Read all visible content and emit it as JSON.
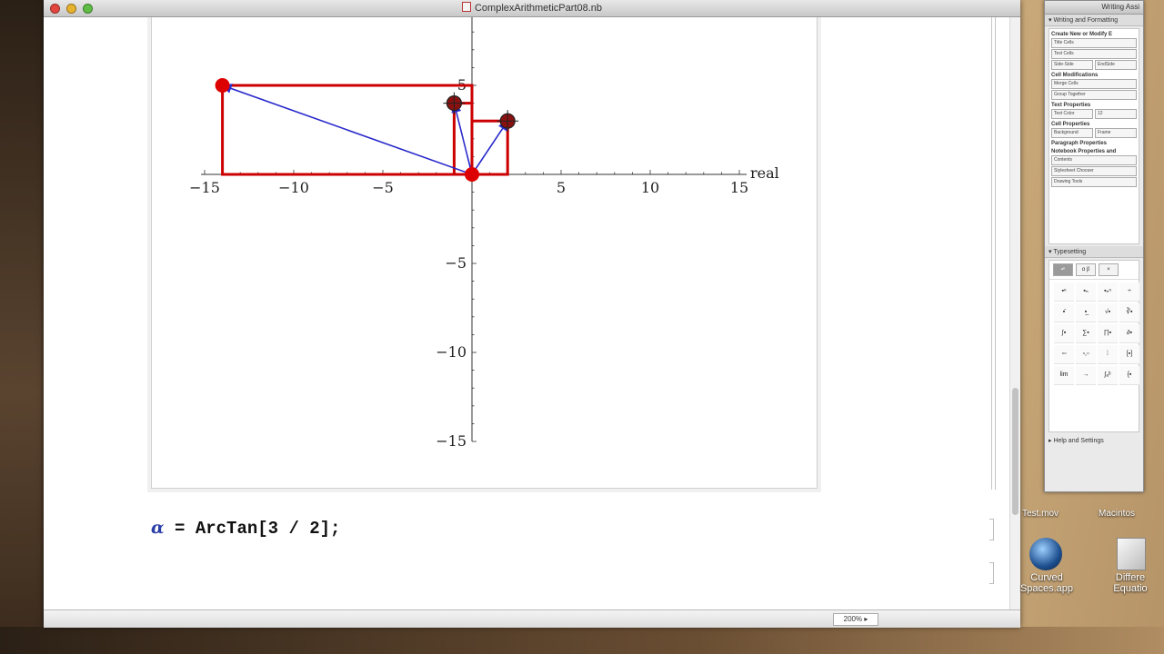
{
  "window": {
    "title": "ComplexArithmeticPart08.nb",
    "zoom": "200%"
  },
  "plot": {
    "x_ticks": [
      "−15",
      "−10",
      "−5",
      "5",
      "10",
      "15"
    ],
    "y_ticks": [
      "5",
      "−5",
      "−10",
      "−15"
    ],
    "x_axis_label": "real",
    "colors": {
      "rect": "#cc0000",
      "arrow": "#2a2acc",
      "point": "#dd0000"
    }
  },
  "chart_data": {
    "type": "scatter",
    "xlabel": "real",
    "ylabel": "",
    "xlim": [
      -15,
      15
    ],
    "ylim": [
      -15,
      5
    ],
    "points": [
      {
        "x": -14,
        "y": 5
      },
      {
        "x": -1,
        "y": 4
      },
      {
        "x": 2,
        "y": 3
      },
      {
        "x": 0,
        "y": 0
      }
    ],
    "arrows": [
      {
        "from": [
          0,
          0
        ],
        "to": [
          -14,
          5
        ]
      },
      {
        "from": [
          0,
          0
        ],
        "to": [
          -1,
          4
        ]
      },
      {
        "from": [
          0,
          0
        ],
        "to": [
          2,
          3
        ]
      }
    ],
    "rectangles": [
      {
        "x0": -14,
        "x1": 0,
        "y0": 0,
        "y1": 5
      },
      {
        "x0": -1,
        "x1": 0,
        "y0": 0,
        "y1": 4
      },
      {
        "x0": 0,
        "x1": 2,
        "y0": 0,
        "y1": 3
      }
    ]
  },
  "cell": {
    "alpha": "α",
    "code": " = ArcTan[3 / 2];"
  },
  "palette": {
    "title": "Writing Assi",
    "section_writing": "Writing and Formatting",
    "create_label": "Create New or Modify E",
    "title_cells": "Title Cells",
    "text_cells": "Text Cells",
    "side_by_side": "Side-Side",
    "end_side": "EndSide",
    "cell_mod_label": "Cell Modifications",
    "merge_cells": "Merge Cells",
    "group_together": "Group Together",
    "text_props_label": "Text Properties",
    "text_color": "Text Color",
    "size": "12",
    "cell_props_label": "Cell Properties",
    "background": "Background",
    "frame": "Frame",
    "para_props_label": "Paragraph Properties",
    "nb_props_label": "Notebook Properties and",
    "contents": "Contents",
    "stylesheet": "Stylesheet Chooser",
    "drawing_tools": "Drawing Tools",
    "section_typesetting": "Typesetting",
    "help": "Help and Settings"
  },
  "desktop": {
    "icon1": "Curved\nSpaces.app",
    "icon2": "Differe\nEquatio",
    "icon3": "Test.mov",
    "icon4": "Macintos"
  }
}
